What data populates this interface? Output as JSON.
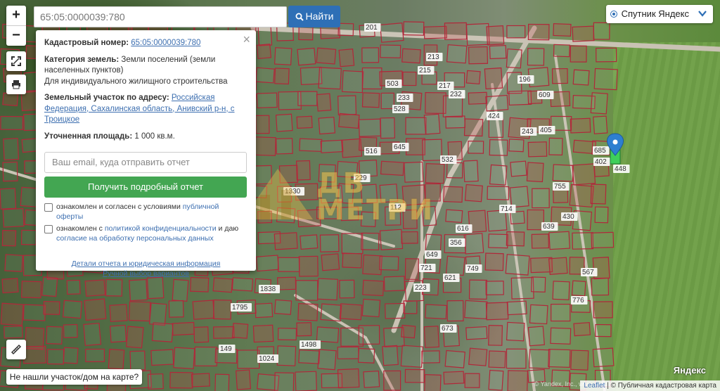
{
  "search": {
    "value": "65:05:0000039:780",
    "button_label": "Найти"
  },
  "zoom": {
    "in_label": "+",
    "out_label": "−"
  },
  "layer_switch": {
    "selected": "Спутник Яндекс"
  },
  "popup": {
    "cadastral_label": "Кадастровый номер:",
    "cadastral_value": "65:05:0000039:780",
    "category_label": "Категория земель:",
    "category_value": "Земли поселений (земли населенных пунктов)",
    "usage": "Для индивидуального жилищного строительства",
    "address_label": "Земельный участок по адресу:",
    "address_value": "Российская Федерация, Сахалинская область, Анивский р-н, с Троицкое",
    "area_label": "Уточненная площадь:",
    "area_value": "1 000 кв.м.",
    "email_placeholder": "Ваш email, куда отправить отчет",
    "report_button": "Получить подробный отчет",
    "consent1_prefix": "ознакомлен и согласен с условиями",
    "consent1_link": "публичной оферты",
    "consent2_prefix": "ознакомлен с",
    "consent2_link1": "политикой конфиденциальности",
    "consent2_mid": "и даю",
    "consent2_link2": "согласие на обработку персональных данных",
    "details_link": "Детали отчета и юридическая информация",
    "manual_link": "Ручной выбор вариантов"
  },
  "not_found_button": "Не нашли участок/дом на карте?",
  "watermark": {
    "text_line1": "ДВ",
    "text_line2": "МЕТРИ"
  },
  "parcel_labels": [
    "1838",
    "1330",
    "1498",
    "1024",
    "149",
    "1795",
    "405",
    "243",
    "685",
    "402",
    "448",
    "755",
    "639",
    "430",
    "567",
    "776",
    "721",
    "223",
    "673",
    "714",
    "356",
    "424",
    "609",
    "532",
    "215",
    "217",
    "233",
    "213",
    "201",
    "503",
    "528",
    "516",
    "645",
    "649",
    "616",
    "749",
    "621",
    "232",
    "112",
    "196",
    "229"
  ],
  "map_footer": {
    "yandex_logo": "Яндекс",
    "copyright": "© Yandex, Inc., www.yandex.ru",
    "attribution_leaflet": "Leaflet",
    "attribution_sep": "|",
    "attribution_text": "© Публичная кадастровая карта"
  },
  "colors": {
    "accent_blue": "#2e6fb6",
    "button_green": "#43a652",
    "parcel_outline": "#b0283a",
    "marker_blue": "#2e7fd0",
    "selected_parcel": "#3ecf5a"
  },
  "icons": {
    "search": "search-icon",
    "fullscreen": "fullscreen-icon",
    "print": "print-icon",
    "ruler": "ruler-icon",
    "marker": "map-marker-icon"
  }
}
